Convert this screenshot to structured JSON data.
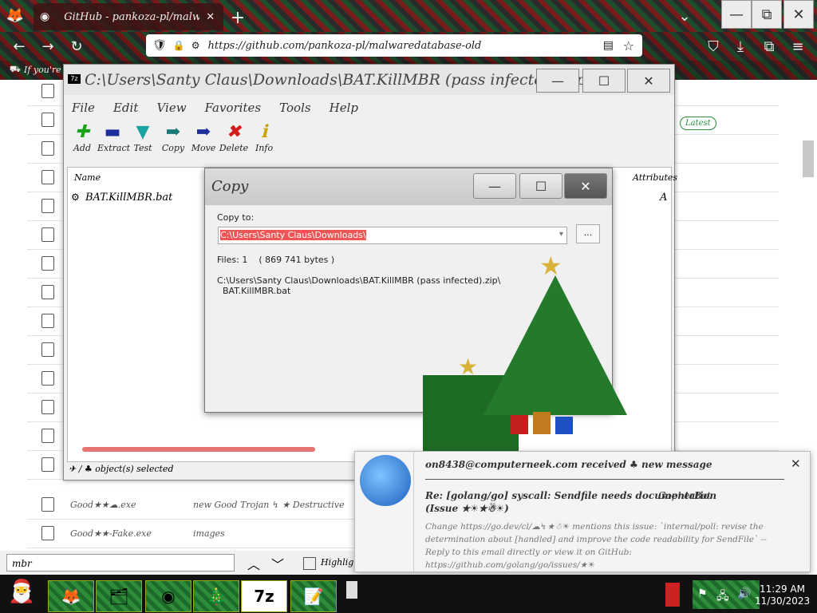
{
  "browser": {
    "tab_title": "GitHub - pankoza-pl/malwaredatabase",
    "url": "https://github.com/pankoza-pl/malwaredatabase-old",
    "bookmark": "If you're go",
    "find_text": "mbr",
    "find_label": "Highlight"
  },
  "page": {
    "label_badge": "Latest",
    "rows": [
      {
        "name": "Good★★☁.exe",
        "desc": "new Good Trojan ↯ ★ Destructive"
      },
      {
        "name": "Good★★-Fake.exe",
        "desc": "images"
      }
    ]
  },
  "zip": {
    "title": "C:\\Users\\Santy Claus\\Downloads\\BAT.KillMBR (pass infected).zip\\",
    "menu": [
      "File",
      "Edit",
      "View",
      "Favorites",
      "Tools",
      "Help"
    ],
    "tools": [
      {
        "label": "Add",
        "icon": "plus-icon",
        "glyph": "✚",
        "color": "#1aa31a"
      },
      {
        "label": "Extract",
        "icon": "minus-icon",
        "glyph": "▬",
        "color": "#1d2d99"
      },
      {
        "label": "Test",
        "icon": "check-icon",
        "glyph": "▼",
        "color": "#1aa3a3"
      },
      {
        "label": "Copy",
        "icon": "copy-arrow-icon",
        "glyph": "➡",
        "color": "#1a7a7a"
      },
      {
        "label": "Move",
        "icon": "move-arrow-icon",
        "glyph": "➡",
        "color": "#1d2d99"
      },
      {
        "label": "Delete",
        "icon": "delete-icon",
        "glyph": "✖",
        "color": "#d01c1c"
      },
      {
        "label": "Info",
        "icon": "info-icon",
        "glyph": "ℹ",
        "color": "#c9a400"
      }
    ],
    "col_name": "Name",
    "col_attr": "Attributes",
    "file": "BAT.KillMBR.bat",
    "attr_val": "A",
    "status": "✈ / ♣ object(s) selected"
  },
  "copy": {
    "title": "Copy",
    "copy_to": "Copy to:",
    "path": "C:\\Users\\Santy Claus\\Downloads\\",
    "browse": "...",
    "files": "Files: 1    ( 869 741 bytes )",
    "src1": "C:\\Users\\Santy Claus\\Downloads\\BAT.KillMBR (pass infected).zip\\",
    "src2": "BAT.KillMBR.bat"
  },
  "notif": {
    "header": "on8438@computerneek.com received ♣ new message",
    "subject": "Re: [golang/go] syscall: Sendfile needs documentation",
    "sender": "GopherBot",
    "issue": "(Issue ★☀★☃☀)",
    "body": "Change https://go.dev/cl/☁↯★☃☀ mentions this issue: `internal/poll: revise the determination about [handled] and improve the code readability for SendFile` -- Reply to this email directly or view it on GitHub: https://github.com/golang/go/issues/★☀"
  },
  "taskbar": {
    "time": "11:29 AM",
    "date": "11/30/2023"
  }
}
